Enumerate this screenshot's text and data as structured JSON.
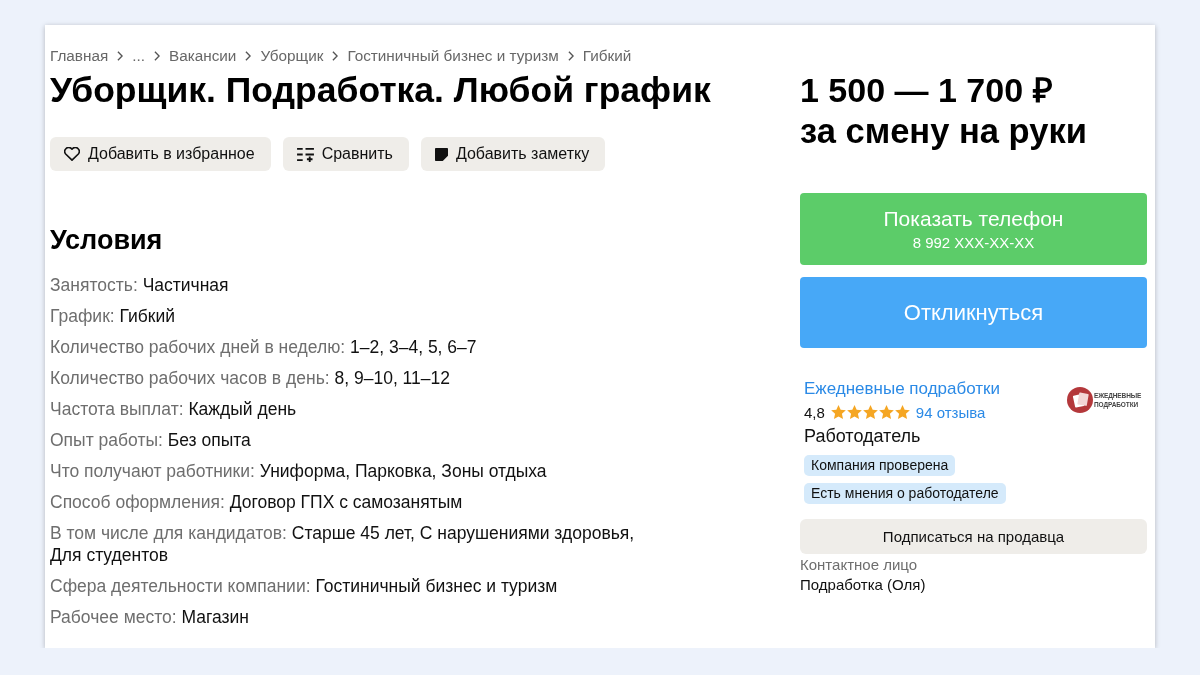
{
  "breadcrumbs": [
    {
      "label": "Главная"
    },
    {
      "label": "..."
    },
    {
      "label": "Вакансии"
    },
    {
      "label": "Уборщик"
    },
    {
      "label": "Гостиничный бизнес и туризм"
    },
    {
      "label": "Гибкий"
    }
  ],
  "title": "Уборщик. Подработка. Любой график",
  "actions": [
    {
      "kind": "favorite",
      "label": "Добавить в избранное"
    },
    {
      "kind": "compare",
      "label": "Сравнить"
    },
    {
      "kind": "note",
      "label": "Добавить заметку"
    }
  ],
  "conditions": {
    "heading": "Условия",
    "rows": [
      {
        "label": "Занятость:",
        "value": "Частичная"
      },
      {
        "label": "График:",
        "value": "Гибкий"
      },
      {
        "label": "Количество рабочих дней в неделю:",
        "value": "1–2, 3–4, 5, 6–7"
      },
      {
        "label": "Количество рабочих часов в день:",
        "value": "8, 9–10, 11–12"
      },
      {
        "label": "Частота выплат:",
        "value": "Каждый день"
      },
      {
        "label": "Опыт работы:",
        "value": "Без опыта"
      },
      {
        "label": "Что получают работники:",
        "value": "Униформа, Парковка, Зоны отдыха"
      },
      {
        "label": "Способ оформления:",
        "value": "Договор ГПХ с самозанятым"
      },
      {
        "label": "В том числе для кандидатов:",
        "value": "Старше 45 лет, С нарушениями здоровья, Для студентов"
      },
      {
        "label": "Сфера деятельности компании:",
        "value": "Гостиничный бизнес и туризм"
      },
      {
        "label": "Рабочее место:",
        "value": "Магазин"
      }
    ]
  },
  "salary": {
    "amount": "1 500 — 1 700 ₽",
    "period": "за смену на руки"
  },
  "phone_button": {
    "label": "Показать телефон",
    "number": "8 992 XXX-XX-XX"
  },
  "respond_button": {
    "label": "Откликнуться"
  },
  "employer": {
    "name": "Ежедневные подработки",
    "rating": "4,8",
    "stars": 5,
    "reviews": "94 отзыва",
    "logo_lines": [
      "ЕЖЕДНЕВНЫЕ",
      "ПОДРАБОТКИ"
    ],
    "role": "Работодатель",
    "badges": [
      "Компания проверена",
      "Есть мнения о работодателе"
    ]
  },
  "subscribe_button": {
    "label": "Подписаться на продавца"
  },
  "contact": {
    "label": "Контактное лицо",
    "name": "Подработка (Оля)"
  }
}
